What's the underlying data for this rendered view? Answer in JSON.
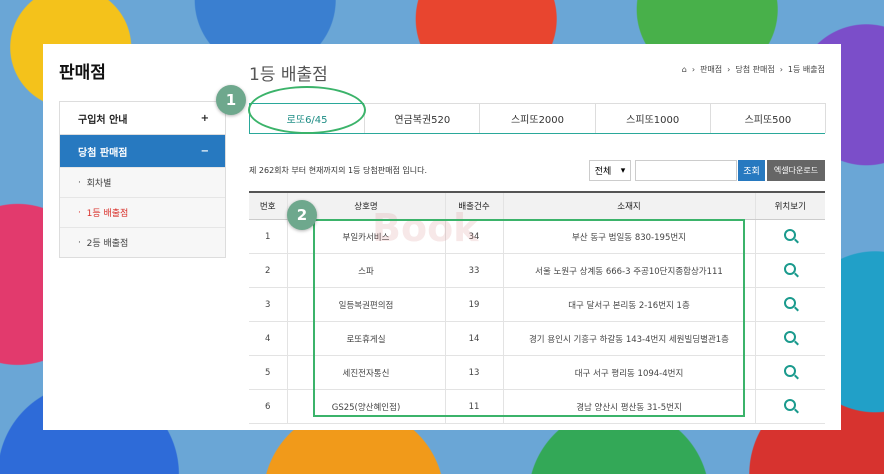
{
  "sidebar": {
    "title": "판매점",
    "items": [
      {
        "label": "구입처 안내",
        "sign": "+"
      },
      {
        "label": "당첨 판매점",
        "sign": "−"
      }
    ],
    "subs": [
      "회차별",
      "1등 배출점",
      "2등 배출점"
    ]
  },
  "main": {
    "title": "1등 배출점",
    "breadcrumb": [
      "판매점",
      "당첨 판매점",
      "1등 배출점"
    ],
    "tabs": [
      "로또6/45",
      "연금복권520",
      "스피또2000",
      "스피또1000",
      "스피또500"
    ],
    "info": "제 262회차 부터 현재까지의 1등 당첨판매점 입니다.",
    "select_value": "전체",
    "search_btn": "조회",
    "excel_btn": "엑셀다운로드"
  },
  "table": {
    "headers": [
      "번호",
      "상호명",
      "배출건수",
      "소재지",
      "위치보기"
    ],
    "rows": [
      [
        "1",
        "부일카서비스",
        "34",
        "부산 동구 범일동 830-195번지"
      ],
      [
        "2",
        "스파",
        "33",
        "서울 노원구 상계동 666-3 주공10단지종합상가111"
      ],
      [
        "3",
        "일등복권편의점",
        "19",
        "대구 달서구 본리동 2-16번지 1층"
      ],
      [
        "4",
        "로또휴게실",
        "14",
        "경기 용인시 기흥구 하갈동 143-4번지 세원빌딩별관1층"
      ],
      [
        "5",
        "세진전자통신",
        "13",
        "대구 서구 평리동 1094-4번지"
      ],
      [
        "6",
        "GS25(양산혜인점)",
        "11",
        "경남 양산시 평산동 31-5번지"
      ]
    ]
  },
  "annotations": {
    "one": "1",
    "two": "2"
  },
  "watermark": "Book",
  "colors": {
    "accent": "#2779c0",
    "tab_accent": "#2aa89a",
    "highlight": "#3bb36a"
  }
}
